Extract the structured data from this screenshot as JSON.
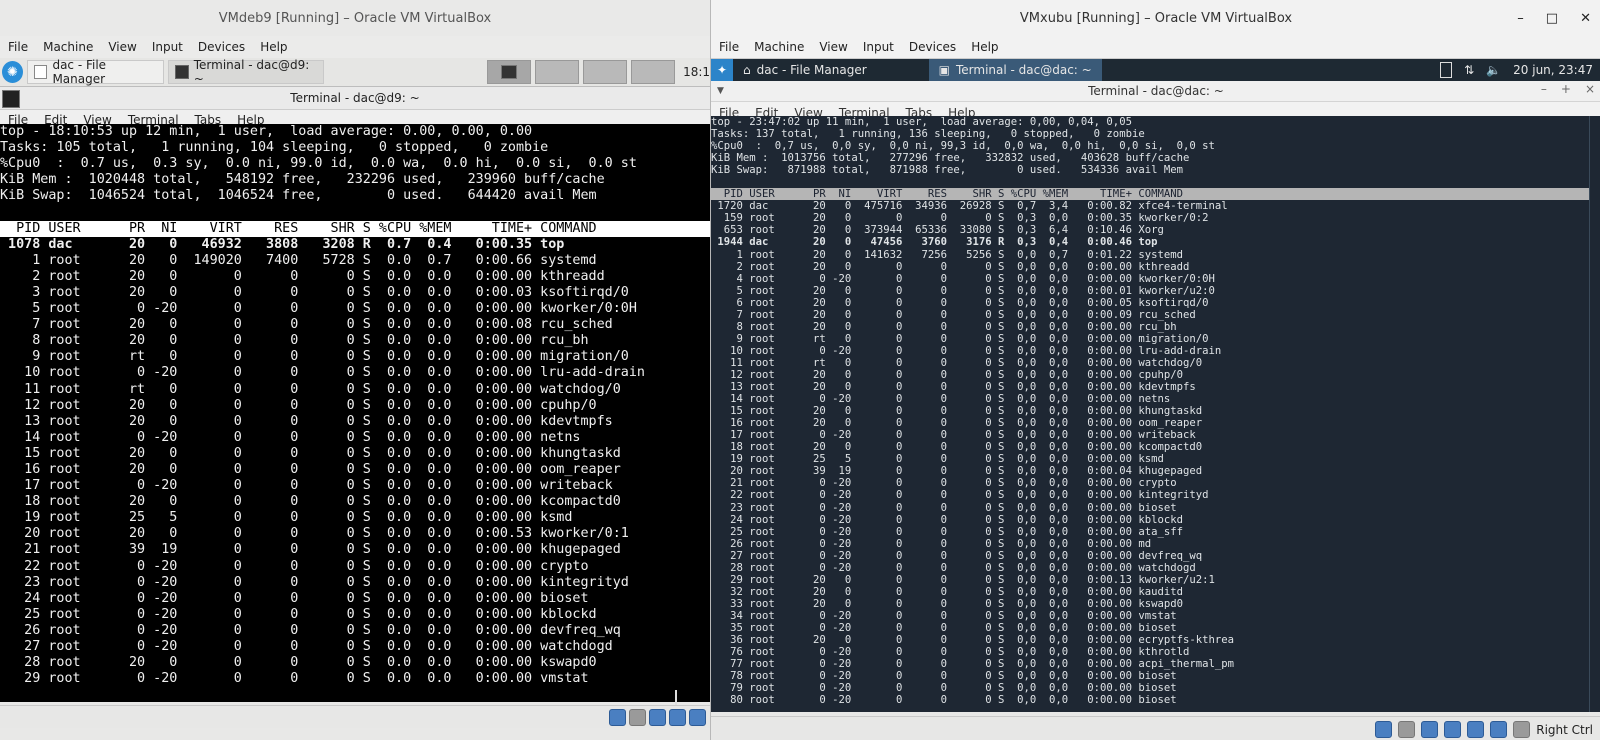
{
  "left_vm": {
    "title": "VMdeb9 [Running] – Oracle VM VirtualBox",
    "menu": [
      "File",
      "Machine",
      "View",
      "Input",
      "Devices",
      "Help"
    ],
    "taskbar": {
      "file_manager": "dac - File Manager",
      "terminal": "Terminal - dac@d9: ~",
      "clock": "18:1"
    },
    "terminal_title": "Terminal - dac@d9: ~",
    "terminal_menu": [
      "File",
      "Edit",
      "View",
      "Terminal",
      "Tabs",
      "Help"
    ],
    "top_lines": [
      "top - 18:10:53 up 12 min,  1 user,  load average: 0.00, 0.00, 0.00",
      "Tasks: 105 total,   1 running, 104 sleeping,   0 stopped,   0 zombie",
      "%Cpu0  :  0.7 us,  0.3 sy,  0.0 ni, 99.0 id,  0.0 wa,  0.0 hi,  0.0 si,  0.0 st",
      "KiB Mem :  1020448 total,   548192 free,   232296 used,   239960 buff/cache",
      "KiB Swap:  1046524 total,  1046524 free,        0 used.   644420 avail Mem",
      ""
    ],
    "table_header": "  PID USER      PR  NI    VIRT    RES    SHR S %CPU %MEM     TIME+ COMMAND",
    "rows": [
      " 1078 dac       20   0   46932   3808   3208 R  0.7  0.4   0:00.35 top",
      "    1 root      20   0  149020   7400   5728 S  0.0  0.7   0:00.66 systemd",
      "    2 root      20   0       0      0      0 S  0.0  0.0   0:00.00 kthreadd",
      "    3 root      20   0       0      0      0 S  0.0  0.0   0:00.03 ksoftirqd/0",
      "    5 root       0 -20       0      0      0 S  0.0  0.0   0:00.00 kworker/0:0H",
      "    7 root      20   0       0      0      0 S  0.0  0.0   0:00.08 rcu_sched",
      "    8 root      20   0       0      0      0 S  0.0  0.0   0:00.00 rcu_bh",
      "    9 root      rt   0       0      0      0 S  0.0  0.0   0:00.00 migration/0",
      "   10 root       0 -20       0      0      0 S  0.0  0.0   0:00.00 lru-add-drain",
      "   11 root      rt   0       0      0      0 S  0.0  0.0   0:00.00 watchdog/0",
      "   12 root      20   0       0      0      0 S  0.0  0.0   0:00.00 cpuhp/0",
      "   13 root      20   0       0      0      0 S  0.0  0.0   0:00.00 kdevtmpfs",
      "   14 root       0 -20       0      0      0 S  0.0  0.0   0:00.00 netns",
      "   15 root      20   0       0      0      0 S  0.0  0.0   0:00.00 khungtaskd",
      "   16 root      20   0       0      0      0 S  0.0  0.0   0:00.00 oom_reaper",
      "   17 root       0 -20       0      0      0 S  0.0  0.0   0:00.00 writeback",
      "   18 root      20   0       0      0      0 S  0.0  0.0   0:00.00 kcompactd0",
      "   19 root      25   5       0      0      0 S  0.0  0.0   0:00.00 ksmd",
      "   20 root      20   0       0      0      0 S  0.0  0.0   0:00.53 kworker/0:1",
      "   21 root      39  19       0      0      0 S  0.0  0.0   0:00.00 khugepaged",
      "   22 root       0 -20       0      0      0 S  0.0  0.0   0:00.00 crypto",
      "   23 root       0 -20       0      0      0 S  0.0  0.0   0:00.00 kintegrityd",
      "   24 root       0 -20       0      0      0 S  0.0  0.0   0:00.00 bioset",
      "   25 root       0 -20       0      0      0 S  0.0  0.0   0:00.00 kblockd",
      "   26 root       0 -20       0      0      0 S  0.0  0.0   0:00.00 devfreq_wq",
      "   27 root       0 -20       0      0      0 S  0.0  0.0   0:00.00 watchdogd",
      "   28 root      20   0       0      0      0 S  0.0  0.0   0:00.00 kswapd0",
      "   29 root       0 -20       0      0      0 S  0.0  0.0   0:00.00 vmstat"
    ]
  },
  "right_vm": {
    "title": "VMxubu [Running] – Oracle VM VirtualBox",
    "window_controls": [
      "–",
      "□",
      "✕"
    ],
    "menu": [
      "File",
      "Machine",
      "View",
      "Input",
      "Devices",
      "Help"
    ],
    "taskbar": {
      "file_manager": "dac - File Manager",
      "terminal": "Terminal - dac@dac: ~",
      "clock": "20 jun, 23:47"
    },
    "terminal_title": "Terminal - dac@dac: ~",
    "terminal_menu": [
      "File",
      "Edit",
      "View",
      "Terminal",
      "Tabs",
      "Help"
    ],
    "host_key": "Right Ctrl",
    "top_lines": [
      "top - 23:47:02 up 11 min,  1 user,  load average: 0,00, 0,04, 0,05",
      "Tasks: 137 total,   1 running, 136 sleeping,   0 stopped,   0 zombie",
      "%Cpu0  :  0,7 us,  0,0 sy,  0,0 ni, 99,3 id,  0,0 wa,  0,0 hi,  0,0 si,  0,0 st",
      "KiB Mem :  1013756 total,   277296 free,   332832 used,   403628 buff/cache",
      "KiB Swap:   871988 total,   871988 free,        0 used.   534336 avail Mem",
      ""
    ],
    "table_header": "  PID USER      PR  NI    VIRT    RES    SHR S %CPU %MEM     TIME+ COMMAND",
    "rows": [
      " 1720 dac       20   0  475716  34936  26928 S  0,7  3,4   0:00.82 xfce4-terminal",
      "  159 root      20   0       0      0      0 S  0,3  0,0   0:00.35 kworker/0:2",
      "  653 root      20   0  373944  65336  33080 S  0,3  6,4   0:10.46 Xorg",
      " 1944 dac       20   0   47456   3760   3176 R  0,3  0,4   0:00.46 top",
      "    1 root      20   0  141632   7256   5256 S  0,0  0,7   0:01.22 systemd",
      "    2 root      20   0       0      0      0 S  0,0  0,0   0:00.00 kthreadd",
      "    4 root       0 -20       0      0      0 S  0,0  0,0   0:00.00 kworker/0:0H",
      "    5 root      20   0       0      0      0 S  0,0  0,0   0:00.01 kworker/u2:0",
      "    6 root      20   0       0      0      0 S  0,0  0,0   0:00.05 ksoftirqd/0",
      "    7 root      20   0       0      0      0 S  0,0  0,0   0:00.09 rcu_sched",
      "    8 root      20   0       0      0      0 S  0,0  0,0   0:00.00 rcu_bh",
      "    9 root      rt   0       0      0      0 S  0,0  0,0   0:00.00 migration/0",
      "   10 root       0 -20       0      0      0 S  0,0  0,0   0:00.00 lru-add-drain",
      "   11 root      rt   0       0      0      0 S  0,0  0,0   0:00.00 watchdog/0",
      "   12 root      20   0       0      0      0 S  0,0  0,0   0:00.00 cpuhp/0",
      "   13 root      20   0       0      0      0 S  0,0  0,0   0:00.00 kdevtmpfs",
      "   14 root       0 -20       0      0      0 S  0,0  0,0   0:00.00 netns",
      "   15 root      20   0       0      0      0 S  0,0  0,0   0:00.00 khungtaskd",
      "   16 root      20   0       0      0      0 S  0,0  0,0   0:00.00 oom_reaper",
      "   17 root       0 -20       0      0      0 S  0,0  0,0   0:00.00 writeback",
      "   18 root      20   0       0      0      0 S  0,0  0,0   0:00.00 kcompactd0",
      "   19 root      25   5       0      0      0 S  0,0  0,0   0:00.00 ksmd",
      "   20 root      39  19       0      0      0 S  0,0  0,0   0:00.04 khugepaged",
      "   21 root       0 -20       0      0      0 S  0,0  0,0   0:00.00 crypto",
      "   22 root       0 -20       0      0      0 S  0,0  0,0   0:00.00 kintegrityd",
      "   23 root       0 -20       0      0      0 S  0,0  0,0   0:00.00 bioset",
      "   24 root       0 -20       0      0      0 S  0,0  0,0   0:00.00 kblockd",
      "   25 root       0 -20       0      0      0 S  0,0  0,0   0:00.00 ata_sff",
      "   26 root       0 -20       0      0      0 S  0,0  0,0   0:00.00 md",
      "   27 root       0 -20       0      0      0 S  0,0  0,0   0:00.00 devfreq_wq",
      "   28 root       0 -20       0      0      0 S  0,0  0,0   0:00.00 watchdogd",
      "   29 root      20   0       0      0      0 S  0,0  0,0   0:00.13 kworker/u2:1",
      "   32 root      20   0       0      0      0 S  0,0  0,0   0:00.00 kauditd",
      "   33 root      20   0       0      0      0 S  0,0  0,0   0:00.00 kswapd0",
      "   34 root       0 -20       0      0      0 S  0,0  0,0   0:00.00 vmstat",
      "   35 root       0 -20       0      0      0 S  0,0  0,0   0:00.00 bioset",
      "   36 root      20   0       0      0      0 S  0,0  0,0   0:00.00 ecryptfs-kthrea",
      "   76 root       0 -20       0      0      0 S  0,0  0,0   0:00.00 kthrotld",
      "   77 root       0 -20       0      0      0 S  0,0  0,0   0:00.00 acpi_thermal_pm",
      "   78 root       0 -20       0      0      0 S  0,0  0,0   0:00.00 bioset",
      "   79 root       0 -20       0      0      0 S  0,0  0,0   0:00.00 bioset",
      "   80 root       0 -20       0      0      0 S  0,0  0,0   0:00.00 bioset"
    ]
  }
}
